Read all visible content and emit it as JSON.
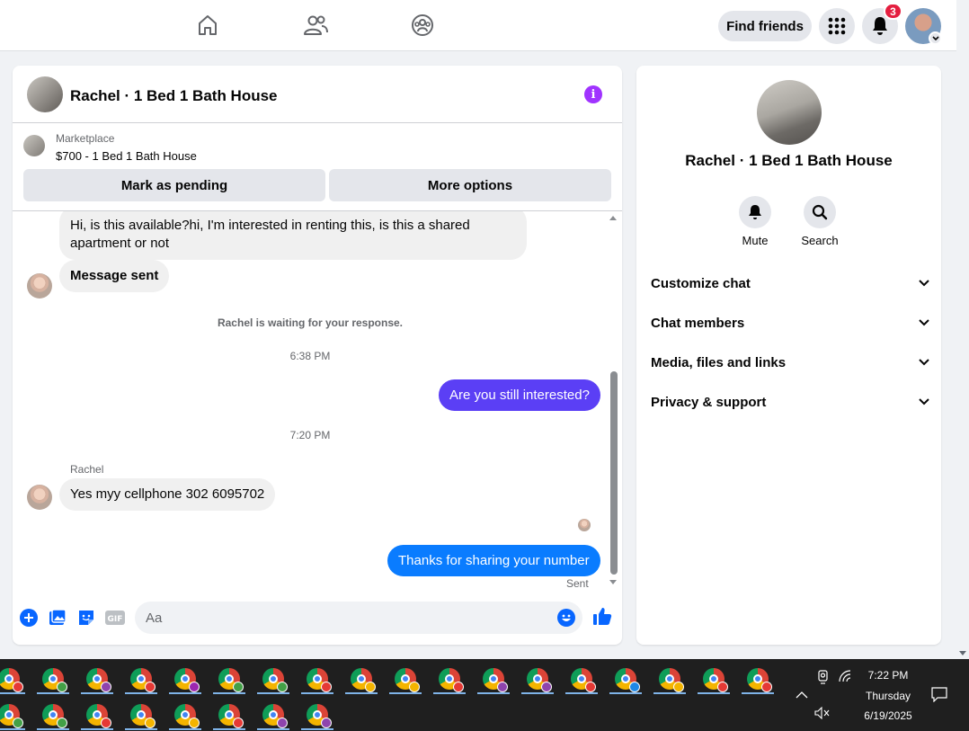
{
  "topnav": {
    "find_friends": "Find friends",
    "notification_count": "3"
  },
  "chat": {
    "title": "Rachel · 1 Bed 1 Bath House",
    "marketplace": {
      "label": "Marketplace",
      "listing": "$700 - 1 Bed 1 Bath House",
      "mark_pending": "Mark as pending",
      "more_options": "More options"
    },
    "messages": {
      "first_msg": "Hi, is this available?hi, I'm  interested  in renting this, is this a shared apartment or not",
      "message_sent": "Message sent",
      "waiting": "Rachel is waiting for your response.",
      "time1": "6:38 PM",
      "out1": "Are you still interested?",
      "time2": "7:20 PM",
      "sender": "Rachel",
      "in2": "Yes myy cellphone 302 6095702",
      "out2": "Thanks for sharing your number",
      "sent_status": "Sent"
    },
    "composer": {
      "placeholder": "Aa"
    }
  },
  "info_panel": {
    "name": "Rachel · 1 Bed 1 Bath House",
    "actions": {
      "mute": "Mute",
      "search": "Search"
    },
    "sections": [
      "Customize chat",
      "Chat members",
      "Media, files and links",
      "Privacy & support"
    ]
  },
  "taskbar": {
    "time": "7:22 PM",
    "day": "Thursday",
    "date": "6/19/2025"
  }
}
